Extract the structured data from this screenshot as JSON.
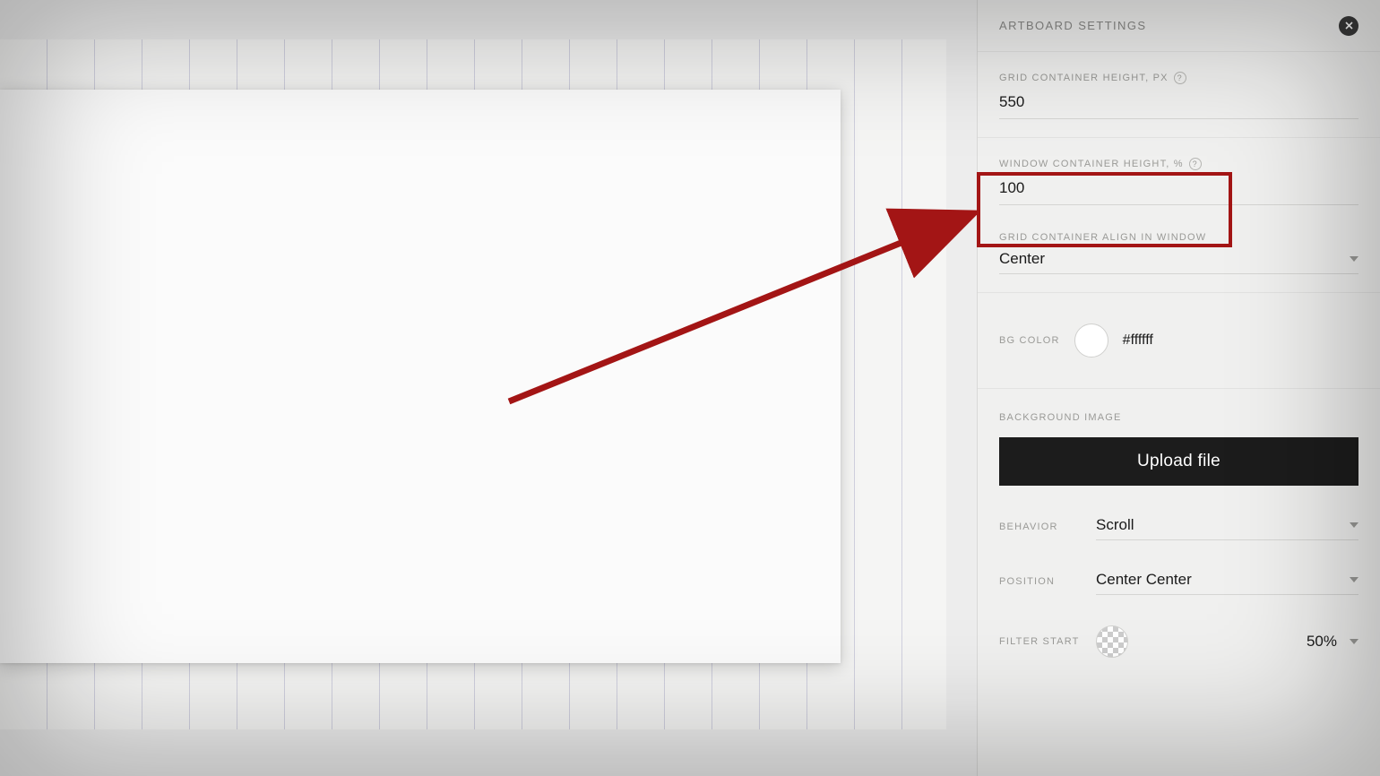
{
  "panel": {
    "title": "ARTBOARD SETTINGS",
    "grid_height_label": "GRID CONTAINER HEIGHT, PX",
    "grid_height_value": "550",
    "window_height_label": "WINDOW CONTAINER HEIGHT, %",
    "window_height_value": "100",
    "align_label": "GRID CONTAINER ALIGN IN WINDOW",
    "align_value": "Center",
    "bgcolor_label": "BG COLOR",
    "bgcolor_hex": "#ffffff",
    "bgimage_label": "BACKGROUND IMAGE",
    "upload_label": "Upload file",
    "behavior_label": "BEHAVIOR",
    "behavior_value": "Scroll",
    "position_label": "POSITION",
    "position_value": "Center Center",
    "filter_label": "FILTER START",
    "filter_value": "50%",
    "help_glyph": "?"
  }
}
